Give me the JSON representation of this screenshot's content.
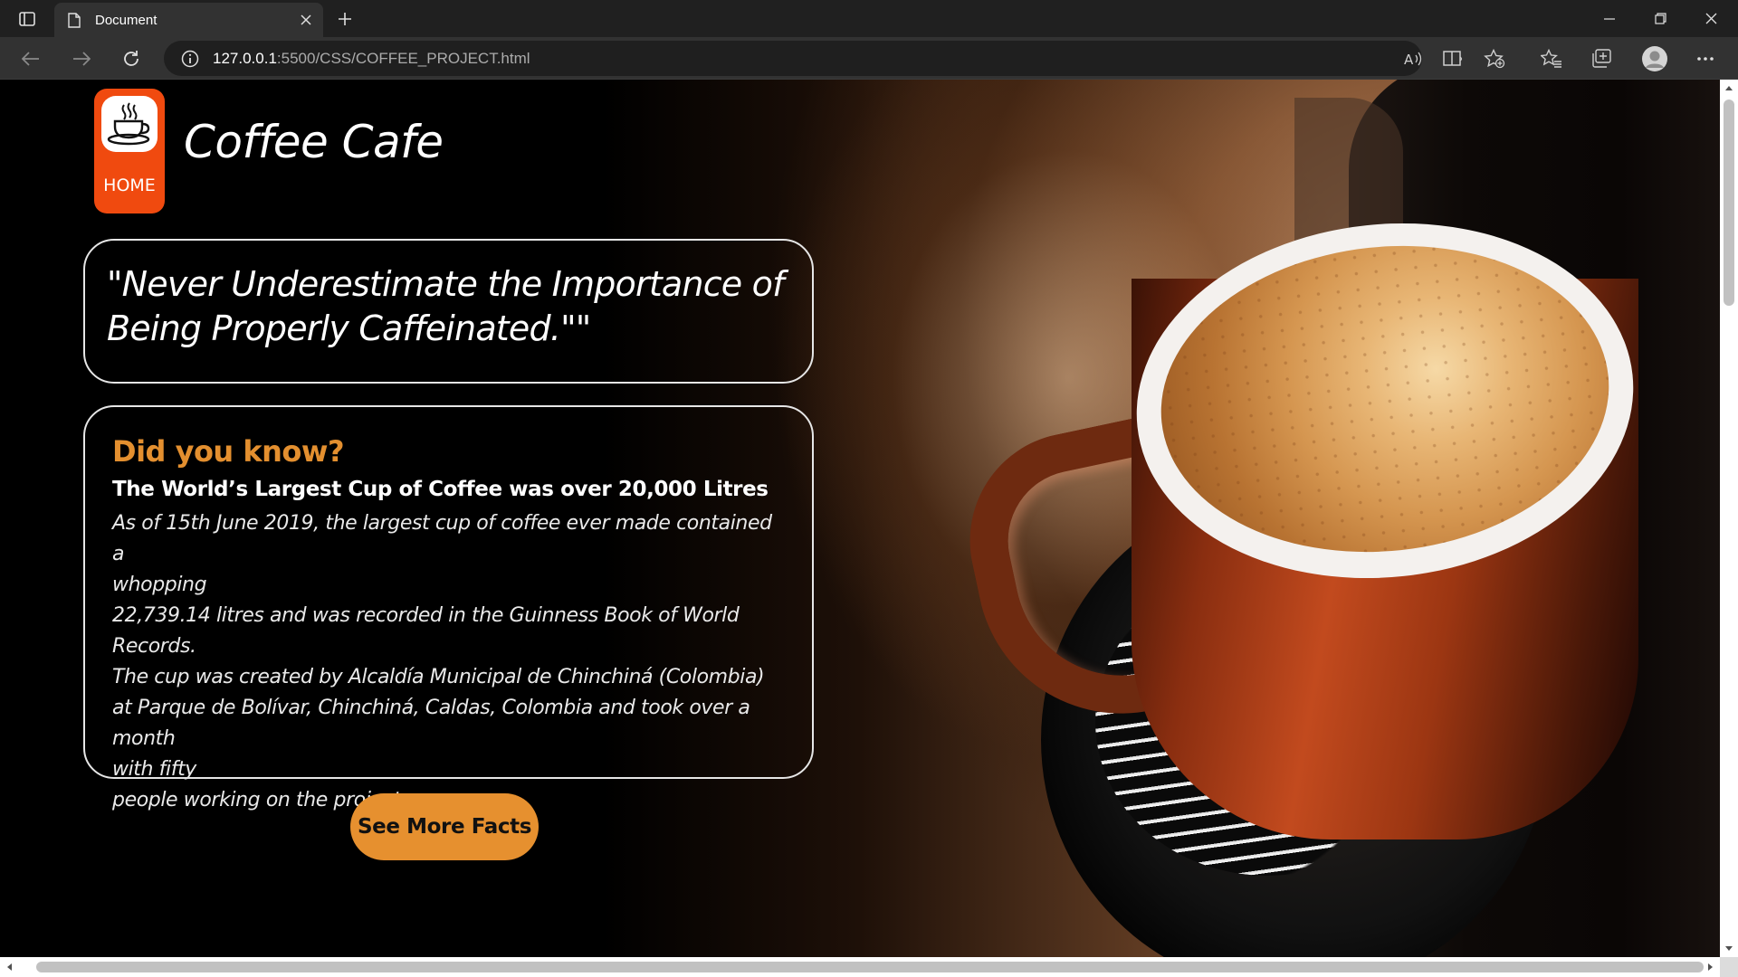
{
  "browser": {
    "tab_title": "Document",
    "url_host": "127.0.0.1",
    "url_rest": ":5500/CSS/COFFEE_PROJECT.html"
  },
  "page": {
    "logo_label": "HOME",
    "brand": "Coffee Cafe",
    "quote": "\"Never Underestimate the Importance of Being Properly Caffeinated.\"\"",
    "facts": {
      "heading": "Did you know?",
      "subheading": "The World’s Largest Cup of Coffee was over 20,000 Litres",
      "lines": [
        "As of 15th June 2019, the largest cup of coffee ever made contained a",
        "whopping",
        "22,739.14 litres and was recorded in the Guinness Book of World Records.",
        "The cup was created by Alcaldía Municipal de Chinchiná (Colombia)",
        "at Parque de Bolívar, Chinchiná, Caldas, Colombia and took over a month",
        "with fifty",
        "people working on the project"
      ]
    },
    "more_button": "See More Facts"
  },
  "colors": {
    "accent_orange": "#e6902f",
    "logo_orange": "#f04a0f",
    "chrome_dark": "#202020"
  },
  "icons": {
    "sidebar": "sidebar-toggle-icon",
    "tab": "document-icon",
    "close": "close-icon",
    "new_tab": "plus-icon",
    "back": "arrow-left-icon",
    "forward": "arrow-right-icon",
    "refresh": "refresh-icon",
    "info": "info-icon",
    "read_aloud": "read-aloud-icon",
    "immersive": "immersive-reader-icon",
    "add_favorite": "add-favorite-icon",
    "favorites": "favorites-icon",
    "collections": "collections-icon",
    "profile": "profile-icon",
    "more": "more-icon"
  }
}
